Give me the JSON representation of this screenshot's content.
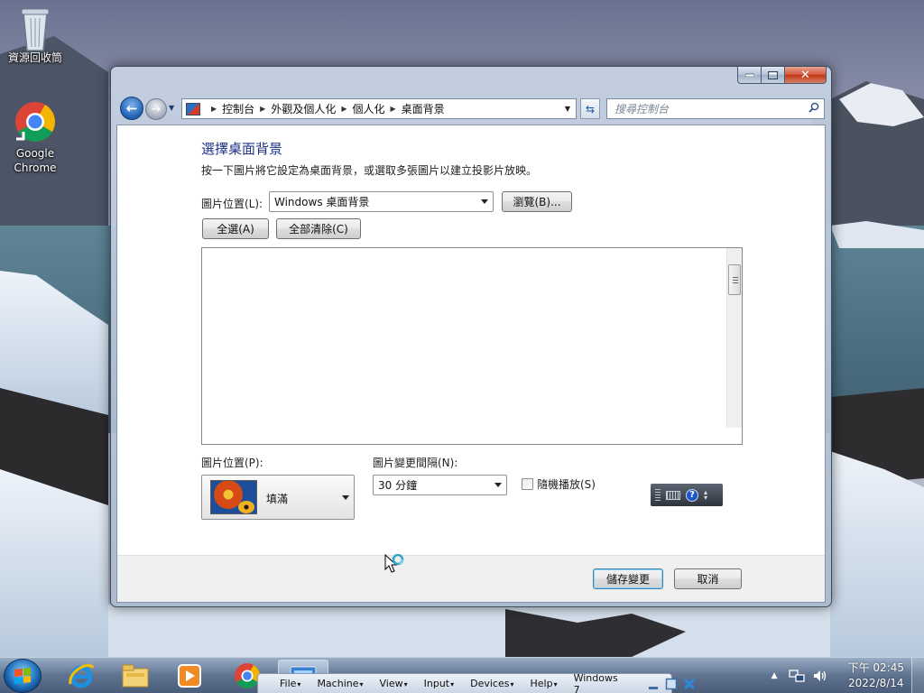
{
  "desktop": {
    "icons": [
      {
        "label": "資源回收筒"
      },
      {
        "label_line1": "Google",
        "label_line2": "Chrome"
      }
    ]
  },
  "window": {
    "address_bar": {
      "crumbs": [
        "控制台",
        "外觀及個人化",
        "個人化",
        "桌面背景"
      ]
    },
    "search": {
      "placeholder": "搜尋控制台"
    },
    "heading": "選擇桌面背景",
    "instruction": "按一下圖片將它設定為桌面背景，或選取多張圖片以建立投影片放映。",
    "picture_location": {
      "label": "圖片位置(L):",
      "value": "Windows 桌面背景",
      "browse_label": "瀏覽(B)..."
    },
    "select_all_label": "全選(A)",
    "clear_all_label": "全部清除(C)",
    "picture_position": {
      "label": "圖片位置(P):",
      "value": "填滿"
    },
    "change_interval": {
      "label": "圖片變更間隔(N):",
      "value": "30 分鐘"
    },
    "shuffle": {
      "label": "隨機播放(S)",
      "checked": false
    },
    "save_label": "儲存變更",
    "cancel_label": "取消"
  },
  "taskbar": {
    "vbox_menus": [
      "File",
      "Machine",
      "View",
      "Input",
      "Devices",
      "Help"
    ],
    "vbox_title": "Windows 7",
    "clock": {
      "time": "下午 02:45",
      "date": "2022/8/14"
    }
  },
  "colors": {
    "heading": "#1e3287",
    "close_button": "#c13513",
    "start_orb": "#1d6fb9"
  },
  "icons": [
    "recycle-bin-icon",
    "chrome-icon",
    "back-icon",
    "forward-icon",
    "refresh-icon",
    "search-icon",
    "help-icon",
    "keyboard-icon",
    "start-icon",
    "internet-explorer-icon",
    "file-explorer-icon",
    "media-player-icon",
    "speaker-icon",
    "network-icon",
    "busy-cursor-icon"
  ]
}
